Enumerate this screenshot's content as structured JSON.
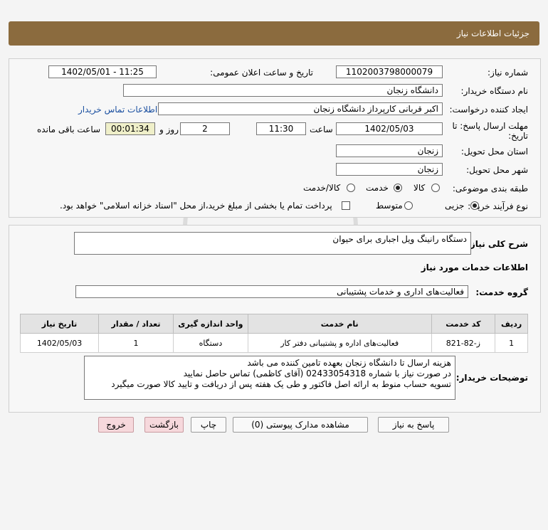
{
  "header": {
    "title": "جزئیات اطلاعات نیاز"
  },
  "info": {
    "need_number_label": "شماره نیاز:",
    "need_number": "1102003798000079",
    "announce_label": "تاریخ و ساعت اعلان عمومی:",
    "announce_value": "1402/05/01 - 11:25",
    "buyer_label": "نام دستگاه خریدار:",
    "buyer": "دانشگاه زنجان",
    "creator_label": "ایجاد کننده درخواست:",
    "creator": "اکبر قربانی کارپرداز دانشگاه زنجان",
    "contact_link": "اطلاعات تماس خریدار",
    "deadline_label_1": "مهلت ارسال پاسخ: تا",
    "deadline_label_2": "تاریخ:",
    "deadline_date": "1402/05/03",
    "time_label": "ساعت",
    "deadline_time": "11:30",
    "days_value": "2",
    "days_label": "روز و",
    "remaining_time": "00:01:34",
    "remaining_label": "ساعت باقی مانده",
    "province_label": "استان محل تحویل:",
    "province": "زنجان",
    "city_label": "شهر محل تحویل:",
    "city": "زنجان",
    "category_label": "طبقه بندی موضوعی:",
    "category_options": [
      "کالا",
      "خدمت",
      "کالا/خدمت"
    ],
    "category_selected": "خدمت",
    "process_label": "نوع فرآیند خرید :",
    "process_options": [
      "جزیی",
      "متوسط"
    ],
    "process_selected": "جزیی",
    "payment_note": "پرداخت تمام یا بخشی از مبلغ خرید،از محل \"اسناد خزانه اسلامی\" خواهد بود."
  },
  "summary": {
    "label": "شرح کلی نیاز:",
    "value": "دستگاه رانینگ ویل اجباری برای حیوان"
  },
  "services": {
    "section_title": "اطلاعات خدمات مورد نیاز",
    "group_label": "گروه خدمت:",
    "group_value": "فعالیت‌های اداری و خدمات پشتیبانی",
    "columns": [
      "ردیف",
      "کد خدمت",
      "نام خدمت",
      "واحد اندازه گیری",
      "تعداد / مقدار",
      "تاریخ نیاز"
    ],
    "rows": [
      [
        "1",
        "ز-82-821",
        "فعالیت‌های اداره و پشتیبانی دفتر کار",
        "دستگاه",
        "1",
        "1402/05/03"
      ]
    ]
  },
  "notes": {
    "label": "توضیحات خریدار:",
    "lines": [
      "هزینه ارسال تا دانشگاه زنجان بعهده تامین کننده می باشد",
      "در صورت نیاز با شماره 02433054318 (آقای کاظمی) تماس حاصل نمایید",
      "تسویه حساب منوط به ارائه اصل فاکتور و طی یک هفته پس از دریافت و تایید کالا صورت میگیرد"
    ]
  },
  "buttons": {
    "reply": "پاسخ به نیاز",
    "attachments": "مشاهده مدارک پیوستی (0)",
    "print": "چاپ",
    "back": "بازگشت",
    "exit": "خروج"
  },
  "colors": {
    "header": "#8b6b3e",
    "timer_bg": "#efefc9",
    "link": "#1a4fa0",
    "pink_button": "#f6d8dc"
  }
}
